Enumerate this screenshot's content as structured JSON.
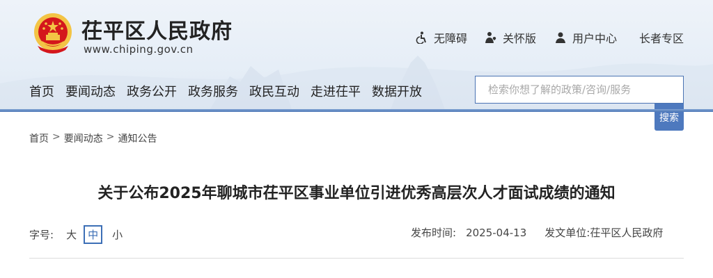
{
  "site": {
    "title": "茌平区人民政府",
    "domain": "www.chiping.gov.cn"
  },
  "utility_links": [
    {
      "label": "无障碍",
      "icon": "accessibility-icon"
    },
    {
      "label": "关怀版",
      "icon": "elder-care-icon"
    },
    {
      "label": "用户中心",
      "icon": "user-icon"
    },
    {
      "label": "长者专区",
      "icon": ""
    }
  ],
  "nav": [
    "首页",
    "要闻动态",
    "政务公开",
    "政务服务",
    "政民互动",
    "走进茌平",
    "数据开放"
  ],
  "search": {
    "placeholder": "检索你想了解的政策/咨询/服务",
    "button_label": "搜索"
  },
  "breadcrumb": [
    "首页",
    "要闻动态",
    "通知公告"
  ],
  "breadcrumb_sep": ">",
  "article": {
    "title": "关于公布2025年聊城市茌平区事业单位引进优秀高层次人才面试成绩的通知",
    "font_size_label": "字号:",
    "font_sizes": [
      "大",
      "中",
      "小"
    ],
    "font_size_selected": "中",
    "publish_label": "发布时间:",
    "publish_date": "2025-04-13",
    "issuer_label": "发文单位:",
    "issuer": "茌平区人民政府"
  },
  "colors": {
    "accent": "#4e79be",
    "header_bg": "#e8eff8",
    "emblem_red": "#d4171c",
    "emblem_gold": "#f3c445"
  }
}
